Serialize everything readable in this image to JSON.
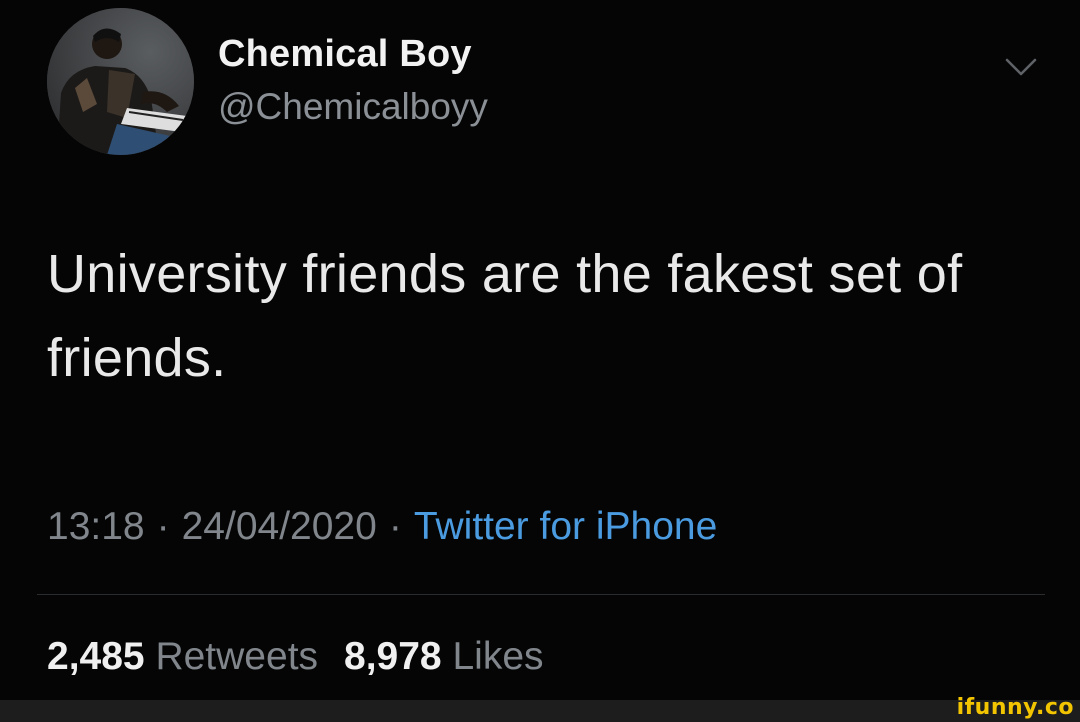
{
  "tweet": {
    "author": {
      "display_name": "Chemical Boy",
      "handle": "@Chemicalboyy",
      "avatar_icon": "avatar-photo"
    },
    "menu_icon": "chevron-down-icon",
    "text": "University friends are the fakest set of friends.",
    "time": "13:18",
    "separator": "·",
    "date": "24/04/2020",
    "source": "Twitter for iPhone",
    "retweets": {
      "count": "2,485",
      "label": "Retweets"
    },
    "likes": {
      "count": "8,978",
      "label": "Likes"
    }
  },
  "watermark": "ifunny.co",
  "colors": {
    "background": "#050505",
    "text": "#e9e9ea",
    "muted": "#80868c",
    "link": "#4a9be0",
    "watermark": "#f3c500"
  }
}
